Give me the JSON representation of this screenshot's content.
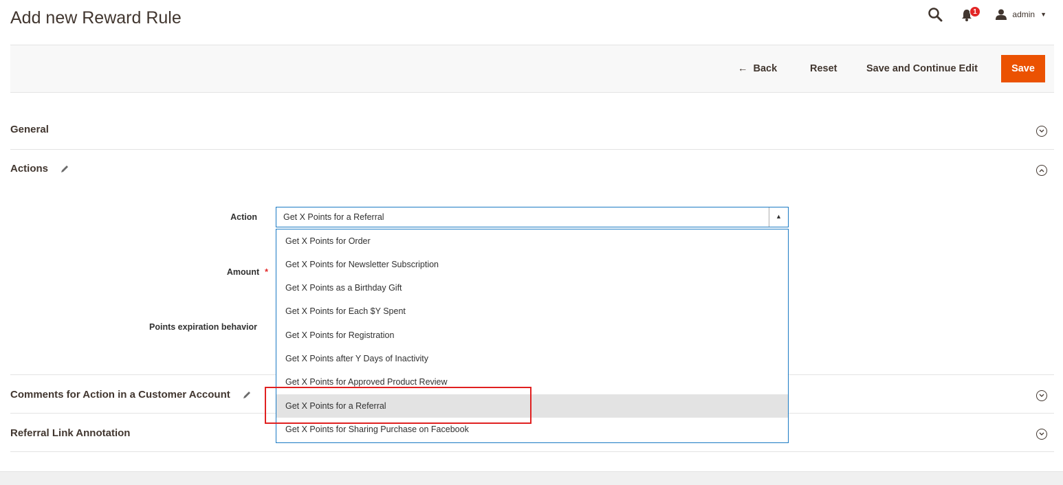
{
  "page": {
    "title": "Add new Reward Rule"
  },
  "header": {
    "user_name": "admin",
    "notification_count": "1"
  },
  "toolbar": {
    "back_label": "Back",
    "reset_label": "Reset",
    "save_continue_label": "Save and Continue Edit",
    "save_label": "Save"
  },
  "sections": {
    "general": {
      "title": "General",
      "state": "collapsed"
    },
    "actions": {
      "title": "Actions",
      "state": "expanded"
    },
    "comments": {
      "title": "Comments for Action in a Customer Account",
      "state": "collapsed"
    },
    "referral": {
      "title": "Referral Link Annotation",
      "state": "collapsed"
    }
  },
  "form": {
    "action_label": "Action",
    "amount_label": "Amount",
    "expiration_label": "Points expiration behavior",
    "action_value": "Get X Points for a Referral"
  },
  "action_options": [
    "Get X Points for Order",
    "Get X Points for Newsletter Subscription",
    "Get X Points as a Birthday Gift",
    "Get X Points for Each $Y Spent",
    "Get X Points for Registration",
    "Get X Points after Y Days of Inactivity",
    "Get X Points for Approved Product Review",
    "Get X Points for a Referral",
    "Get X Points for Sharing Purchase on Facebook"
  ],
  "selected_option_index": 7,
  "colors": {
    "accent": "#eb5202",
    "focus_border": "#1979c3",
    "annotation": "#e02020",
    "badge": "#e22626"
  }
}
